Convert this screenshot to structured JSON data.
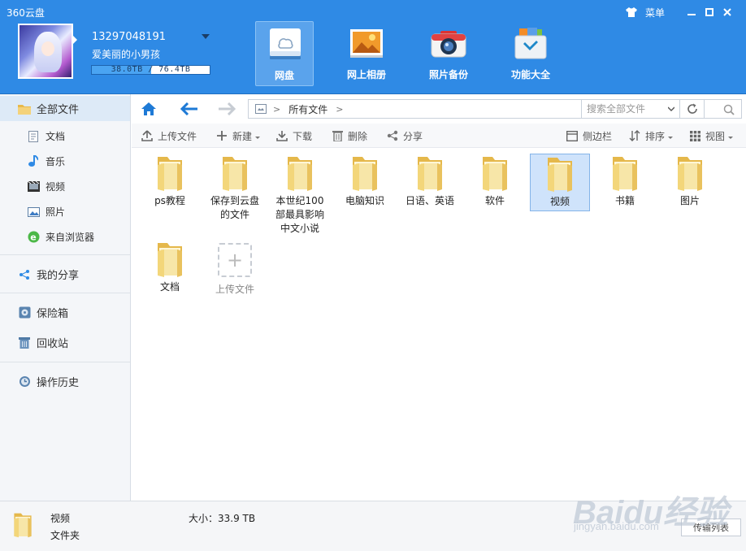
{
  "window": {
    "title": "360云盘",
    "menu_label": "菜单"
  },
  "account": {
    "phone": "13297048191",
    "nickname": "爱美丽的小男孩",
    "quota_text": "38.0TB / 76.4TB",
    "quota_used_fraction": 0.5
  },
  "top_nav": [
    {
      "label": "网盘",
      "icon": "cloud-drive-icon",
      "active": true
    },
    {
      "label": "网上相册",
      "icon": "photo-album-icon",
      "active": false
    },
    {
      "label": "照片备份",
      "icon": "camera-icon",
      "active": false
    },
    {
      "label": "功能大全",
      "icon": "toolbox-icon",
      "active": false
    }
  ],
  "sidebar": {
    "all_files": "全部文件",
    "types": [
      "文档",
      "音乐",
      "视频",
      "照片",
      "来自浏览器"
    ],
    "my_share": "我的分享",
    "safe_box": "保险箱",
    "recycle_bin": "回收站",
    "history": "操作历史"
  },
  "address": {
    "crumb": "所有文件",
    "search_placeholder": "搜索全部文件"
  },
  "actions": {
    "upload": "上传文件",
    "new": "新建",
    "download": "下载",
    "delete": "删除",
    "share": "分享",
    "sidebar_toggle": "侧边栏",
    "sort": "排序",
    "view": "视图"
  },
  "files": [
    {
      "name": "ps教程"
    },
    {
      "name": "保存到云盘的文件"
    },
    {
      "name": "本世纪100部最具影响中文小说"
    },
    {
      "name": "电脑知识"
    },
    {
      "name": "日语、英语"
    },
    {
      "name": "软件"
    },
    {
      "name": "视频",
      "selected": true
    },
    {
      "name": "书籍"
    },
    {
      "name": "图片"
    },
    {
      "name": "文档"
    }
  ],
  "upload_tile_label": "上传文件",
  "status": {
    "name": "视频",
    "type": "文件夹",
    "size": "大小：33.9 TB",
    "transfer_button": "传输列表"
  },
  "watermark": {
    "brand": "Baidu经验",
    "url": "jingyan.baidu.com"
  },
  "colors": {
    "header_blue": "#2f8ae5",
    "selected_bg": "#cfe3fb",
    "folder_yellow": "#f3d67a",
    "accent_blue": "#1e7ad6"
  }
}
